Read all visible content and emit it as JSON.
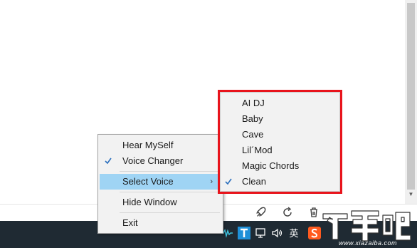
{
  "context_menu": {
    "items": [
      {
        "label": "Hear MySelf",
        "checked": false
      },
      {
        "label": "Voice Changer",
        "checked": true
      },
      {
        "label": "Select Voice",
        "checked": false,
        "has_submenu": true,
        "highlighted": true
      },
      {
        "label": "Hide Window",
        "checked": false
      },
      {
        "label": "Exit",
        "checked": false
      }
    ],
    "submenu_arrow": "›"
  },
  "voice_submenu": {
    "items": [
      {
        "label": "AI DJ",
        "checked": false
      },
      {
        "label": "Baby",
        "checked": false
      },
      {
        "label": "Cave",
        "checked": false
      },
      {
        "label": "Lil´Mod",
        "checked": false
      },
      {
        "label": "Magic Chords",
        "checked": false
      },
      {
        "label": "Clean",
        "checked": true
      }
    ],
    "outline_color": "#e8141c"
  },
  "toolbar": {
    "icons": [
      "rocket-icon",
      "refresh-icon",
      "trash-icon"
    ]
  },
  "taskbar": {
    "tray": {
      "chevron": "^",
      "ime_label": "英",
      "icons": [
        "wave-icon",
        "t-app-icon",
        "network-icon",
        "volume-icon",
        "sogou-icon"
      ]
    }
  },
  "colors": {
    "taskbar": "#1f2a33",
    "menu_bg": "#f2f2f2",
    "highlight": "#9fd4f4",
    "check": "#2b6fbd"
  },
  "watermark": {
    "text": "下载吧",
    "url": "www.xiazaiba.com"
  }
}
